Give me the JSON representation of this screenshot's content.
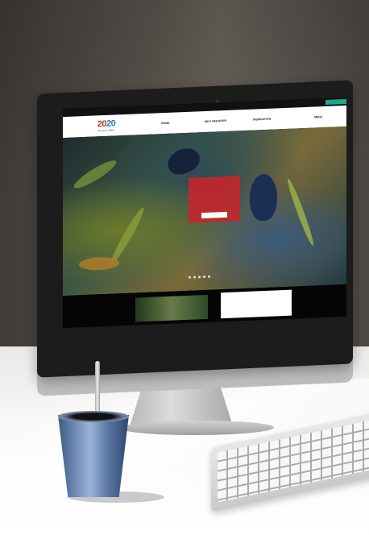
{
  "site": {
    "topbar_text": "",
    "register_label": "",
    "logo": {
      "number_left": "20",
      "number_right": "20",
      "subtitle": "AUCKLAND"
    },
    "nav": [
      "HOME",
      "WHY REGISTER",
      "INSPIRATION",
      "MENU"
    ]
  },
  "hero": {
    "promo_title": "",
    "promo_text": "",
    "promo_button": ""
  },
  "below": {
    "card_title": "",
    "card_text": ""
  },
  "colors": {
    "accent_red": "#c1272d",
    "accent_teal": "#19a890",
    "logo_blue": "#1d7fb8"
  },
  "icons": [
    "camera-icon"
  ]
}
